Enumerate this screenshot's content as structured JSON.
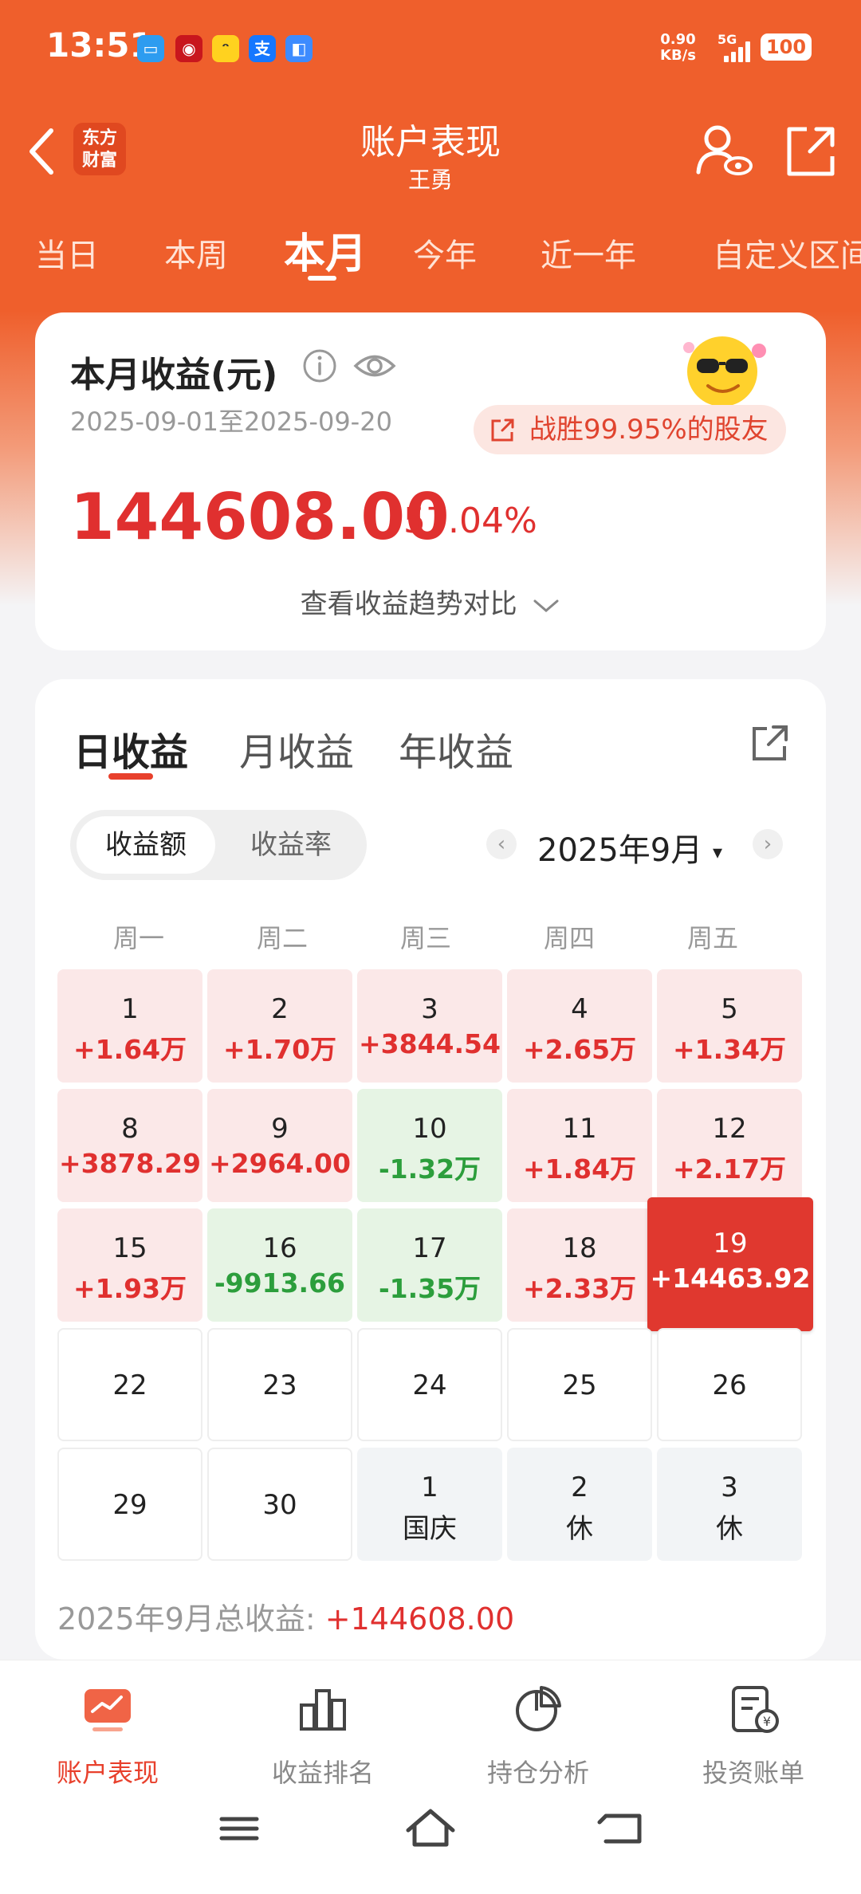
{
  "status_bar": {
    "time": "13:51",
    "network_speed_value": "0.90",
    "network_speed_unit": "KB/s",
    "signal": "5G",
    "battery": "100"
  },
  "nav": {
    "logo_line1": "东方",
    "logo_line2": "财富",
    "title": "账户表现",
    "subtitle": "王勇"
  },
  "period_tabs": [
    "当日",
    "本周",
    "本月",
    "今年",
    "近一年",
    "自定义区间"
  ],
  "active_period": "本月",
  "summary": {
    "title": "本月收益(元)",
    "date_range": "2025-09-01至2025-09-20",
    "rank_text": "战胜99.95%的股友",
    "value": "144608.00",
    "percent": "57.04%",
    "trend_link": "查看收益趋势对比"
  },
  "income_tabs": [
    "日收益",
    "月收益",
    "年收益"
  ],
  "segment": {
    "on": "收益额",
    "off": "收益率"
  },
  "month_label": "2025年9月",
  "weekdays": [
    "周一",
    "周二",
    "周三",
    "周四",
    "周五"
  ],
  "calendar": [
    [
      {
        "day": "1",
        "value": "+1.64万",
        "type": "pos"
      },
      {
        "day": "2",
        "value": "+1.70万",
        "type": "pos"
      },
      {
        "day": "3",
        "value": "+3844.54",
        "type": "pos"
      },
      {
        "day": "4",
        "value": "+2.65万",
        "type": "pos"
      },
      {
        "day": "5",
        "value": "+1.34万",
        "type": "pos"
      }
    ],
    [
      {
        "day": "8",
        "value": "+3878.29",
        "type": "pos"
      },
      {
        "day": "9",
        "value": "+2964.00",
        "type": "pos"
      },
      {
        "day": "10",
        "value": "-1.32万",
        "type": "neg"
      },
      {
        "day": "11",
        "value": "+1.84万",
        "type": "pos"
      },
      {
        "day": "12",
        "value": "+2.17万",
        "type": "pos"
      }
    ],
    [
      {
        "day": "15",
        "value": "+1.93万",
        "type": "pos"
      },
      {
        "day": "16",
        "value": "-9913.66",
        "type": "neg"
      },
      {
        "day": "17",
        "value": "-1.35万",
        "type": "neg"
      },
      {
        "day": "18",
        "value": "+2.33万",
        "type": "pos"
      },
      {
        "day": "19",
        "value": "+14463.92",
        "type": "hi"
      }
    ],
    [
      {
        "day": "22",
        "value": "",
        "type": "empty"
      },
      {
        "day": "23",
        "value": "",
        "type": "empty"
      },
      {
        "day": "24",
        "value": "",
        "type": "empty"
      },
      {
        "day": "25",
        "value": "",
        "type": "empty"
      },
      {
        "day": "26",
        "value": "",
        "type": "empty"
      }
    ],
    [
      {
        "day": "29",
        "value": "",
        "type": "empty"
      },
      {
        "day": "30",
        "value": "",
        "type": "empty"
      },
      {
        "day": "1",
        "value": "国庆",
        "type": "hol"
      },
      {
        "day": "2",
        "value": "休",
        "type": "hol"
      },
      {
        "day": "3",
        "value": "休",
        "type": "hol"
      }
    ]
  ],
  "total": {
    "label": "2025年9月总收益: ",
    "value": "+144608.00"
  },
  "bottom_nav": [
    {
      "label": "账户表现",
      "icon": "chart-monitor-icon",
      "active": true
    },
    {
      "label": "收益排名",
      "icon": "bar-chart-icon",
      "active": false
    },
    {
      "label": "持仓分析",
      "icon": "pie-chart-icon",
      "active": false
    },
    {
      "label": "投资账单",
      "icon": "bill-icon",
      "active": false
    }
  ],
  "colors": {
    "brand": "#ef5f2c",
    "gain": "#e0302f",
    "loss": "#2c9e3c"
  }
}
